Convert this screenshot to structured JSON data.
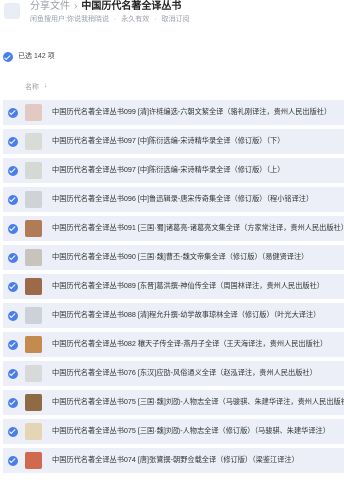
{
  "header": {
    "breadcrumb_root": "分享文件",
    "breadcrumb_sep": "›",
    "title": "中国历代名著全译丛书",
    "subline": [
      "闲鱼搜用户:你说我稍晓说",
      "·",
      "永久有效",
      "·",
      "取消订阅"
    ]
  },
  "selection": {
    "text": "已选 142 项"
  },
  "column": {
    "name_label": "名称",
    "sort_icon": "↓"
  },
  "files": [
    {
      "name": "中国历代名著全译丛书099 [清]许梿编选-六朝文絜全译（骆礼刚译注，贵州人民出版社）",
      "thumb_color": "#e2c9c2"
    },
    {
      "name": "中国历代名著全译丛书097 [中]陈衍选编-宋诗精华录全译（修订版）（下）",
      "thumb_color": "#d8dbd6"
    },
    {
      "name": "中国历代名著全译丛书097 [中]陈衍选编-宋诗精华录全译（修订版）（上）",
      "thumb_color": "#d5d9d6"
    },
    {
      "name": "中国历代名著全译丛书096 [中]鲁迅辑录-唐宋传奇集全译（修订版）（程小铭译注）",
      "thumb_color": "#cfd3d8"
    },
    {
      "name": "中国历代名著全译丛书091 [三国·蜀]诸葛亮-诸葛亮文集全译（方家常注译，贵州人民出版社）",
      "thumb_color": "#b07c55"
    },
    {
      "name": "中国历代名著全译丛书090 [三国·魏]曹丕-魏文帝集全译（修订版）（易健贤译注）",
      "thumb_color": "#c9c3bd"
    },
    {
      "name": "中国历代名著全译丛书089 [东晋]葛洪撰-神仙传全译（周国林译注，贵州人民出版社）",
      "thumb_color": "#9c6a48"
    },
    {
      "name": "中国历代名著全译丛书088 [清]程允升撰-幼学故事琼林全译（修订版）（叶光大译注）",
      "thumb_color": "#cdd2d8"
    },
    {
      "name": "中国历代名著全译丛书082 穰天子传全译-燕丹子全译（王天海译注，贵州人民出版社）",
      "thumb_color": "#c48a4e"
    },
    {
      "name": "中国历代名著全译丛书076 [东汉]应劭-风俗通义全译（赵泓译注，贵州人民出版社）",
      "thumb_color": "#d7d9da"
    },
    {
      "name": "中国历代名著全译丛书075 [三国·魏]刘劭-人物志全译（马骏骐、朱建华译注，贵州人民出版社）",
      "thumb_color": "#8e6b44"
    },
    {
      "name": "中国历代名著全译丛书075 [三国·魏]刘劭-人物志全译（修订版）（马骏骐、朱建华译注）",
      "thumb_color": "#e4d6b5"
    },
    {
      "name": "中国历代名著全译丛书074 [唐]张鷟撰-朝野佥载全译（修订版）（梁鉴江译注）",
      "thumb_color": "#d06a4e"
    }
  ]
}
